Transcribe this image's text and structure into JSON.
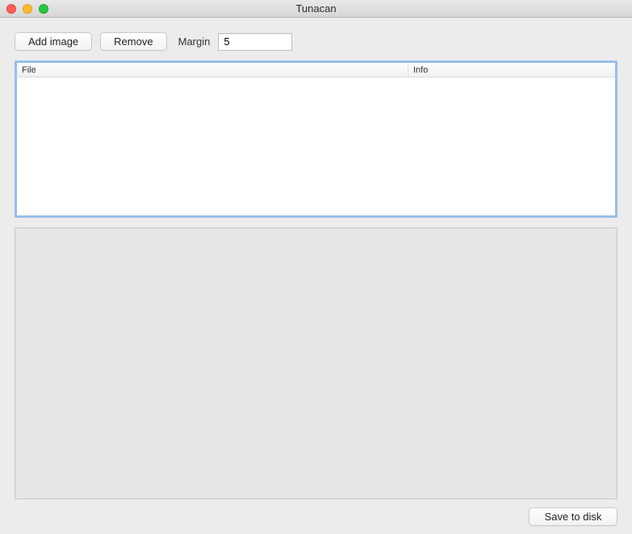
{
  "window": {
    "title": "Tunacan"
  },
  "toolbar": {
    "add_image_label": "Add image",
    "remove_label": "Remove",
    "margin_label": "Margin",
    "margin_value": "5"
  },
  "table": {
    "columns": {
      "file": "File",
      "info": "Info"
    },
    "rows": []
  },
  "footer": {
    "save_label": "Save to disk"
  }
}
